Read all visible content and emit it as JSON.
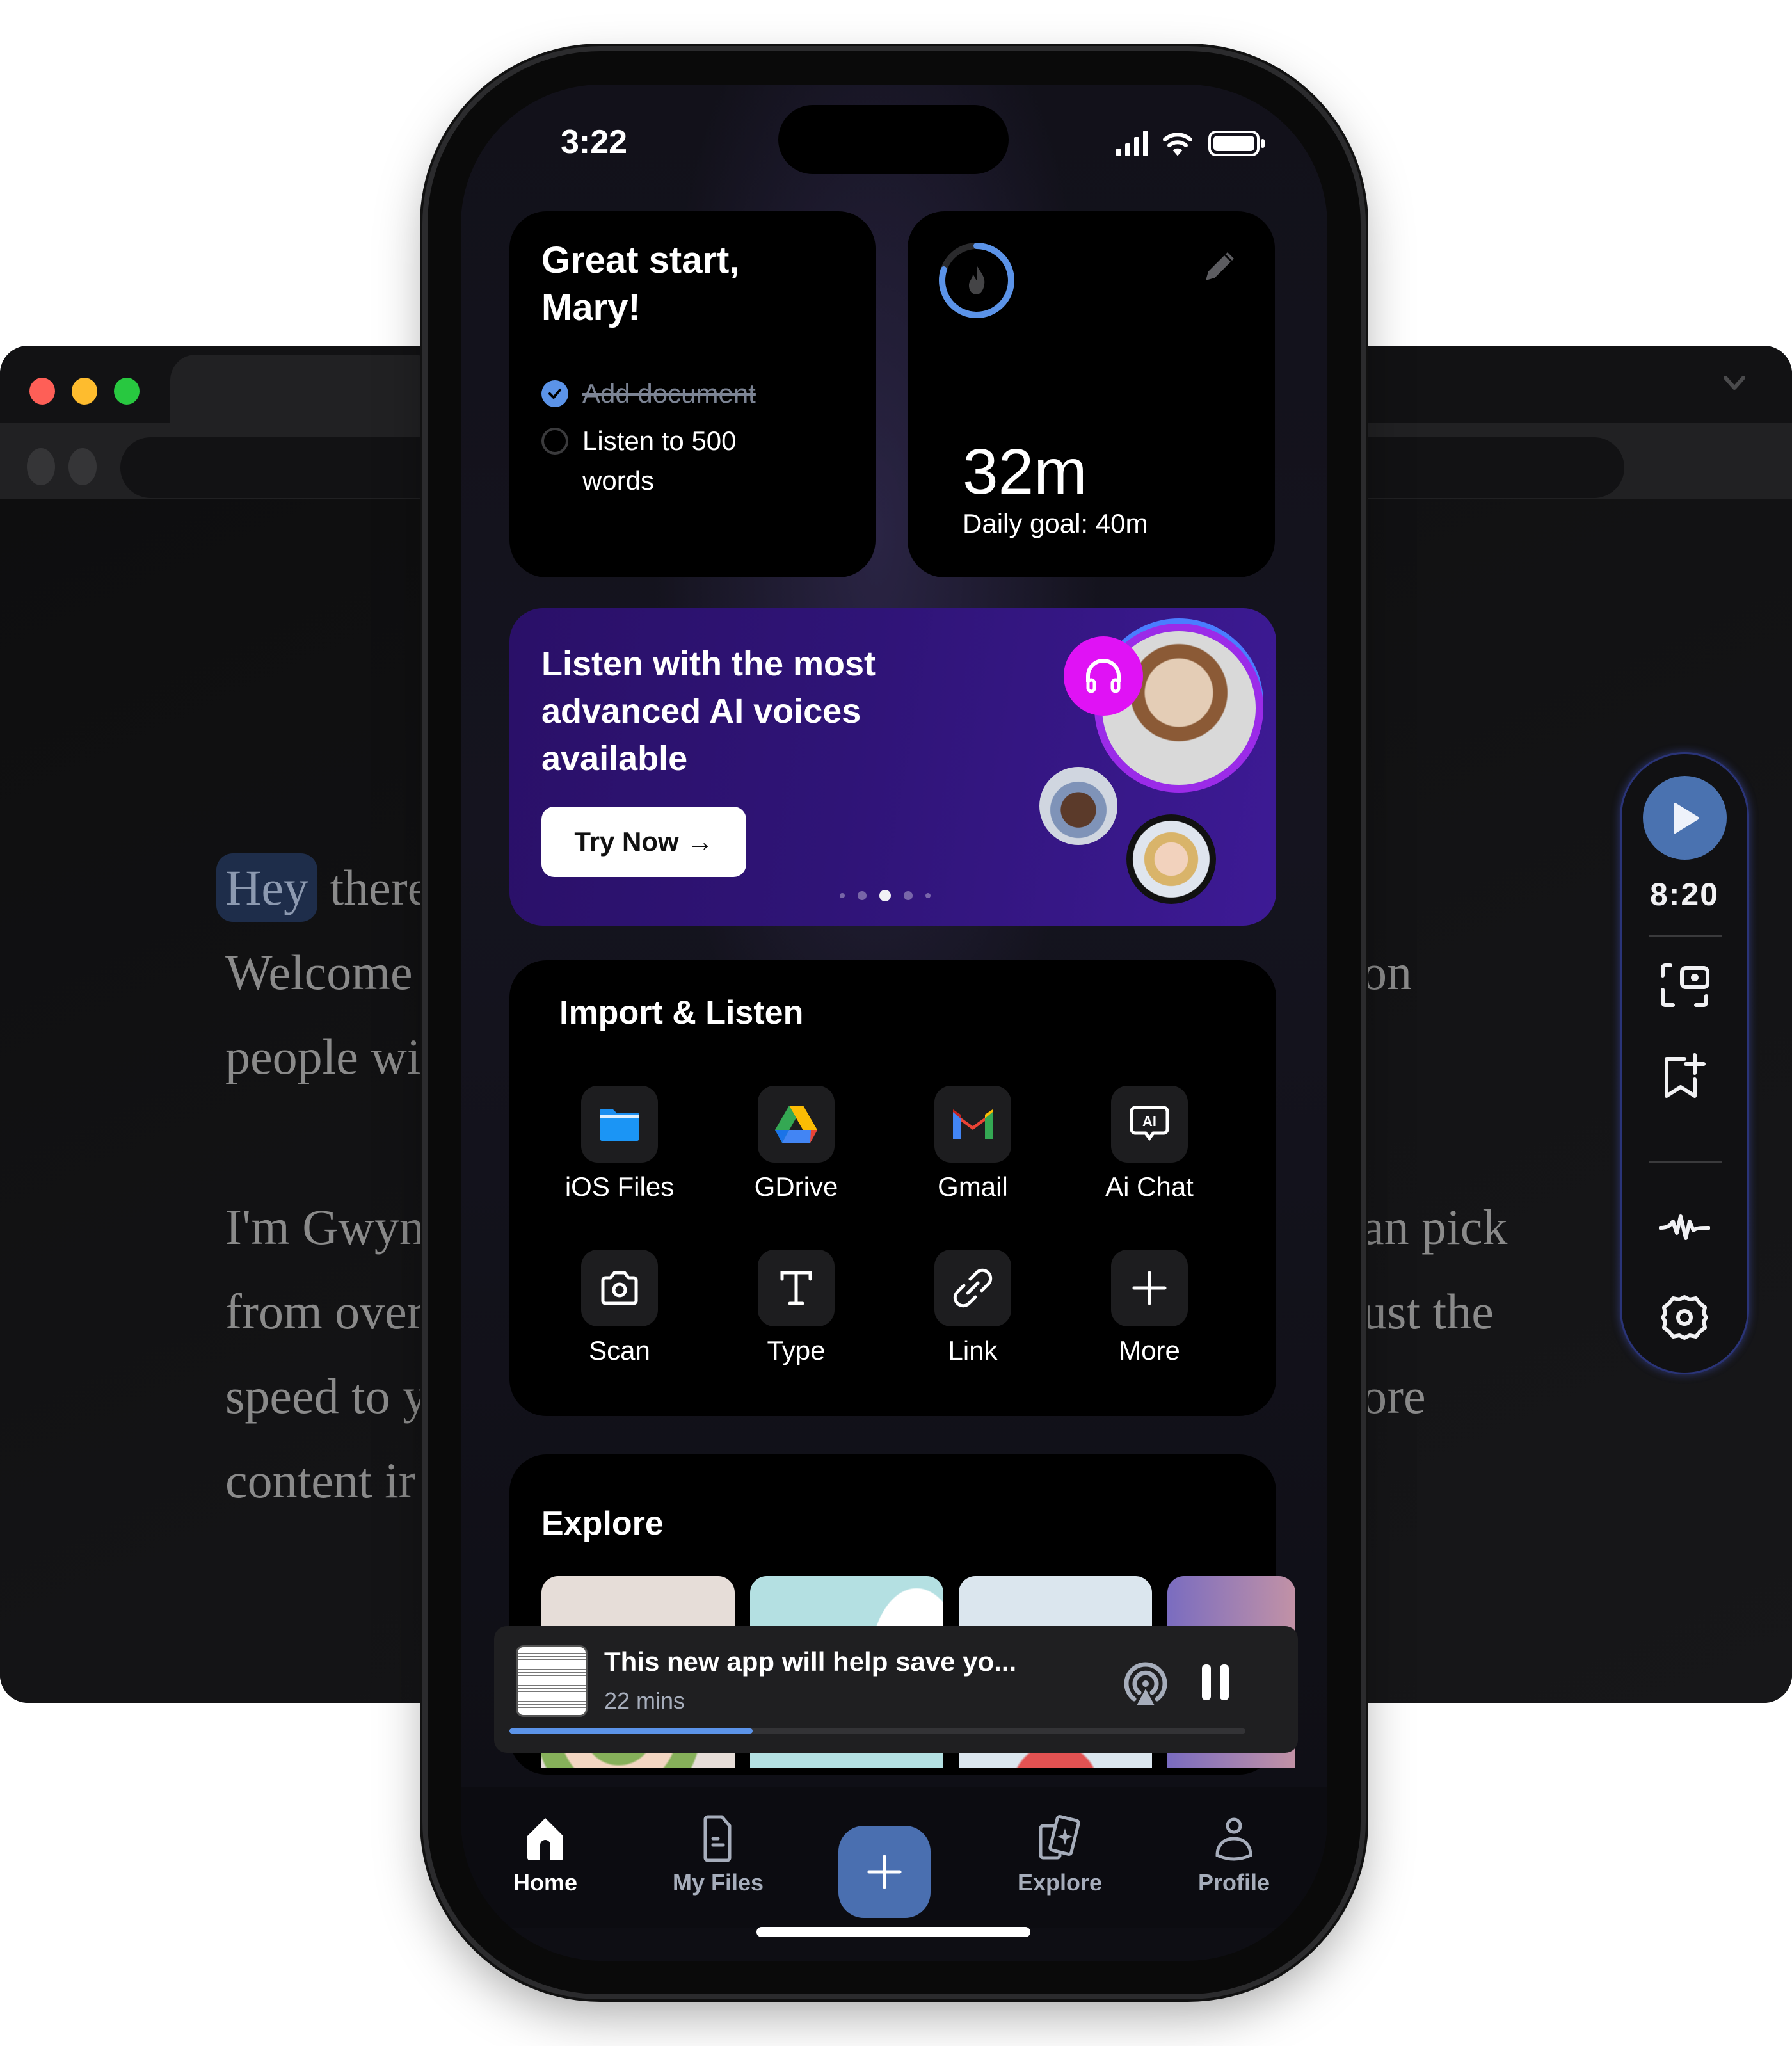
{
  "browser": {
    "tab_close_glyph": "✕",
    "document_lines_left": [
      "there",
      "Welcome",
      "people wi",
      "",
      "I'm Gwyn",
      "from over",
      "speed to y",
      "content ir"
    ],
    "highlighted_word": "Hey",
    "document_lines_right": [
      "on",
      "",
      "",
      "an pick",
      "ust the",
      "ore"
    ]
  },
  "floating_toolbar": {
    "time": "8:20",
    "icons": [
      "play-icon",
      "screenshot-camera-icon",
      "bookmark-add-icon",
      "voice-wave-icon",
      "settings-gear-icon"
    ]
  },
  "status_bar": {
    "time": "3:22"
  },
  "greeting_card": {
    "title": "Great start, Mary!",
    "tasks": [
      {
        "label": "Add document",
        "done": true
      },
      {
        "label": "Listen to 500 words",
        "done": false
      }
    ]
  },
  "goal_card": {
    "value": "32m",
    "subtitle": "Daily goal: 40m",
    "progress_fraction": 0.8
  },
  "promo": {
    "title": "Listen with the most advanced AI voices available",
    "button_label": "Try Now",
    "button_arrow": "→",
    "carousel_dots": 5,
    "carousel_active_index": 2
  },
  "import": {
    "title": "Import & Listen",
    "items": [
      {
        "label": "iOS Files",
        "icon": "folder-icon"
      },
      {
        "label": "GDrive",
        "icon": "google-drive-icon"
      },
      {
        "label": "Gmail",
        "icon": "gmail-icon"
      },
      {
        "label": "Ai Chat",
        "icon": "ai-chat-icon"
      },
      {
        "label": "Scan",
        "icon": "camera-icon"
      },
      {
        "label": "Type",
        "icon": "text-type-icon"
      },
      {
        "label": "Link",
        "icon": "link-icon"
      },
      {
        "label": "More",
        "icon": "plus-icon"
      }
    ]
  },
  "explore": {
    "title": "Explore"
  },
  "mini_player": {
    "title": "This new app will help save yo...",
    "subtitle": "22 mins",
    "progress_percent": 33
  },
  "tabbar": {
    "items": [
      {
        "label": "Home",
        "active": true
      },
      {
        "label": "My Files",
        "active": false
      },
      {
        "label": "Explore",
        "active": false
      },
      {
        "label": "Profile",
        "active": false
      }
    ]
  },
  "colors": {
    "accent_blue": "#5b93e8",
    "button_blue": "#4a72b0",
    "promo_purple": "#2f1477",
    "headphone_magenta": "#e012f5"
  }
}
